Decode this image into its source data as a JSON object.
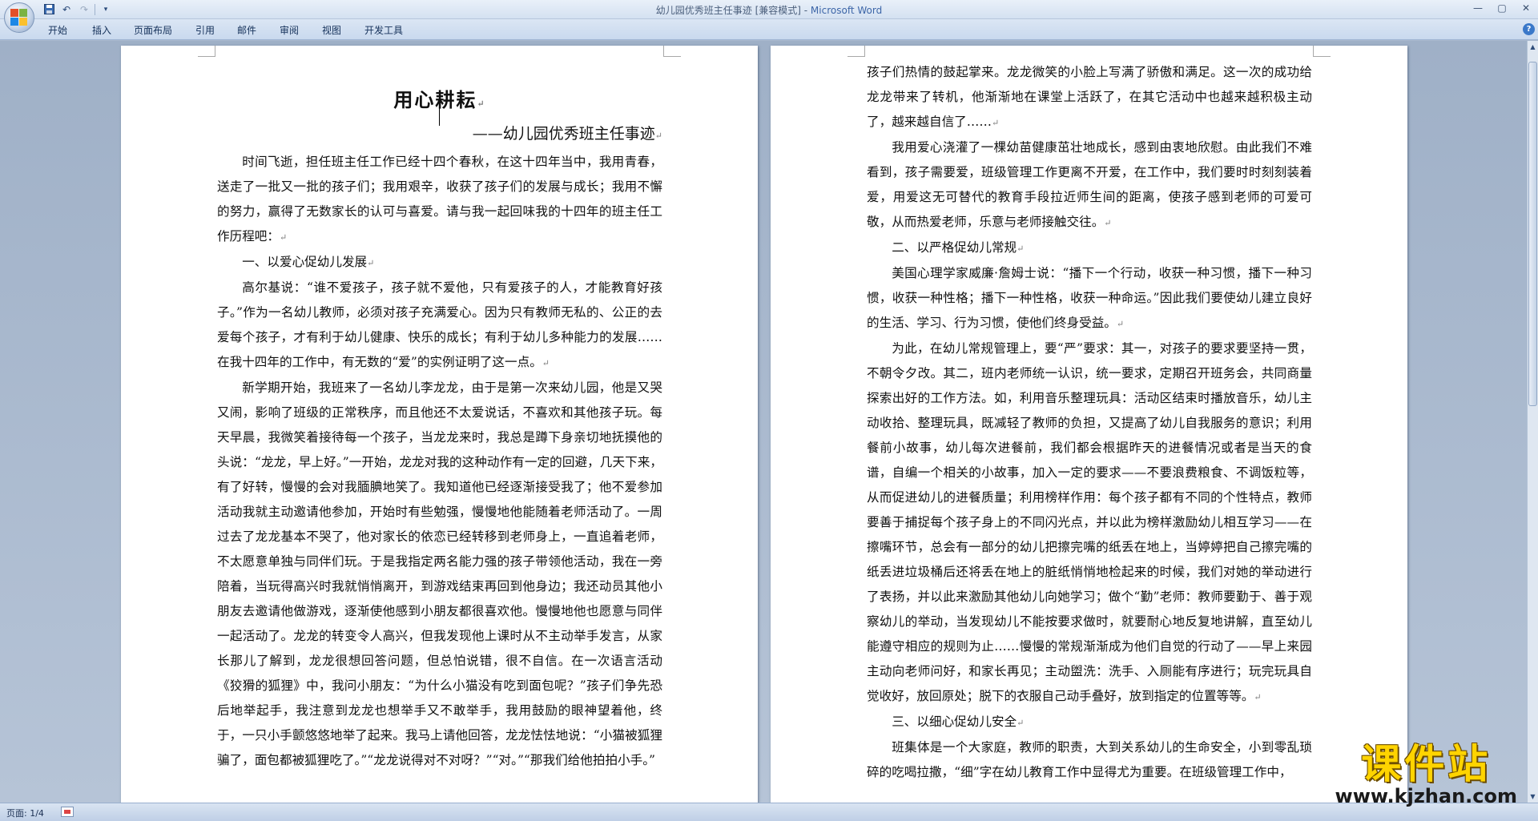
{
  "window": {
    "title_doc": "幼儿园优秀班主任事迹 [兼容模式] - ",
    "title_app": "Microsoft Word"
  },
  "ribbon_tabs": [
    "开始",
    "插入",
    "页面布局",
    "引用",
    "邮件",
    "审阅",
    "视图",
    "开发工具"
  ],
  "document": {
    "title": "用心耕耘",
    "subtitle": "——幼儿园优秀班主任事迹",
    "left_paragraphs": [
      "时间飞逝，担任班主任工作已经十四个春秋，在这十四年当中，我用青春，送走了一批又一批的孩子们；我用艰辛，收获了孩子们的发展与成长；我用不懈的努力，赢得了无数家长的认可与喜爱。请与我一起回味我的十四年的班主任工作历程吧：",
      "一、以爱心促幼儿发展",
      "高尔基说：“谁不爱孩子，孩子就不爱他，只有爱孩子的人，才能教育好孩子。”作为一名幼儿教师，必须对孩子充满爱心。因为只有教师无私的、公正的去爱每个孩子，才有利于幼儿健康、快乐的成长；有利于幼儿多种能力的发展……在我十四年的工作中，有无数的“爱”的实例证明了这一点。",
      "新学期开始，我班来了一名幼儿李龙龙，由于是第一次来幼儿园，他是又哭又闹，影响了班级的正常秩序，而且他还不太爱说话，不喜欢和其他孩子玩。每天早晨，我微笑着接待每一个孩子，当龙龙来时，我总是蹲下身亲切地抚摸他的头说：“龙龙，早上好。”一开始，龙龙对我的这种动作有一定的回避，几天下来，有了好转，慢慢的会对我腼腆地笑了。我知道他已经逐渐接受我了；他不爱参加活动我就主动邀请他参加，开始时有些勉强，慢慢地他能随着老师活动了。一周过去了龙龙基本不哭了，他对家长的依恋已经转移到老师身上，一直追着老师，不太愿意单独与同伴们玩。于是我指定两名能力强的孩子带领他活动，我在一旁陪着，当玩得高兴时我就悄悄离开，到游戏结束再回到他身边；我还动员其他小朋友去邀请他做游戏，逐渐使他感到小朋友都很喜欢他。慢慢地他也愿意与同伴一起活动了。龙龙的转变令人高兴，但我发现他上课时从不主动举手发言，从家长那儿了解到，龙龙很想回答问题，但总怕说错，很不自信。在一次语言活动《狡猾的狐狸》中，我问小朋友：“为什么小猫没有吃到面包呢？”孩子们争先恐后地举起手，我注意到龙龙也想举手又不敢举手，我用鼓励的眼神望着他，终于，一只小手颤悠悠地举了起来。我马上请他回答，龙龙怯怯地说：“小猫被狐狸骗了，面包都被狐狸吃了。”“龙龙说得对不对呀？”“对。”“那我们给他拍拍小手。”"
    ],
    "right_paragraphs": [
      "孩子们热情的鼓起掌来。龙龙微笑的小脸上写满了骄傲和满足。这一次的成功给龙龙带来了转机，他渐渐地在课堂上活跃了，在其它活动中也越来越积极主动了，越来越自信了……",
      "我用爱心浇灌了一棵幼苗健康茁壮地成长，感到由衷地欣慰。由此我们不难看到，孩子需要爱，班级管理工作更离不开爱，在工作中，我们要时时刻刻装着爱，用爱这无可替代的教育手段拉近师生间的距离，使孩子感到老师的可爱可敬，从而热爱老师，乐意与老师接触交往。",
      "二、以严格促幼儿常规",
      "美国心理学家威廉·詹姆士说：“播下一个行动，收获一种习惯，播下一种习惯，收获一种性格；播下一种性格，收获一种命运。”因此我们要使幼儿建立良好的生活、学习、行为习惯，使他们终身受益。",
      "为此，在幼儿常规管理上，要“严”要求：其一，对孩子的要求要坚持一贯，不朝令夕改。其二，班内老师统一认识，统一要求，定期召开班务会，共同商量探索出好的工作方法。如，利用音乐整理玩具：活动区结束时播放音乐，幼儿主动收拾、整理玩具，既减轻了教师的负担，又提高了幼儿自我服务的意识；利用餐前小故事，幼儿每次进餐前，我们都会根据昨天的进餐情况或者是当天的食谱，自编一个相关的小故事，加入一定的要求——不要浪费粮食、不调饭粒等，从而促进幼儿的进餐质量；利用榜样作用：每个孩子都有不同的个性特点，教师要善于捕捉每个孩子身上的不同闪光点，并以此为榜样激励幼儿相互学习——在擦嘴环节，总会有一部分的幼儿把擦完嘴的纸丢在地上，当婷婷把自己擦完嘴的纸丢进垃圾桶后还将丢在地上的脏纸悄悄地检起来的时候，我们对她的举动进行了表扬，并以此来激励其他幼儿向她学习；做个“勤”老师：教师要勤于、善于观察幼儿的举动，当发现幼儿不能按要求做时，就要耐心地反复地讲解，直至幼儿能遵守相应的规则为止……慢慢的常规渐渐成为他们自觉的行动了——早上来园主动向老师问好，和家长再见；主动盥洗：洗手、入厕能有序进行；玩完玩具自觉收好，放回原处；脱下的衣服自己动手叠好，放到指定的位置等等。",
      "三、以细心促幼儿安全",
      "班集体是一个大家庭，教师的职责，大到关系幼儿的生命安全，小到零乱琐碎的吃喝拉撒，“细”字在幼儿教育工作中显得尤为重要。在班级管理工作中，"
    ]
  },
  "status": {
    "page_info": "页面: 1/4"
  },
  "watermark": {
    "text": "课件站",
    "url": "www.kjzhan.com"
  },
  "colors": {
    "workspace_bg": "#a9b9ce",
    "ribbon_bg": "#d4e1f1",
    "watermark_yellow": "#ffd400"
  },
  "icons": [
    "office-button-icon",
    "save-icon",
    "undo-icon",
    "redo-icon",
    "customize-qat-icon",
    "minimize-icon",
    "maximize-icon",
    "close-icon",
    "help-icon",
    "scroll-up-icon",
    "scroll-down-icon"
  ]
}
